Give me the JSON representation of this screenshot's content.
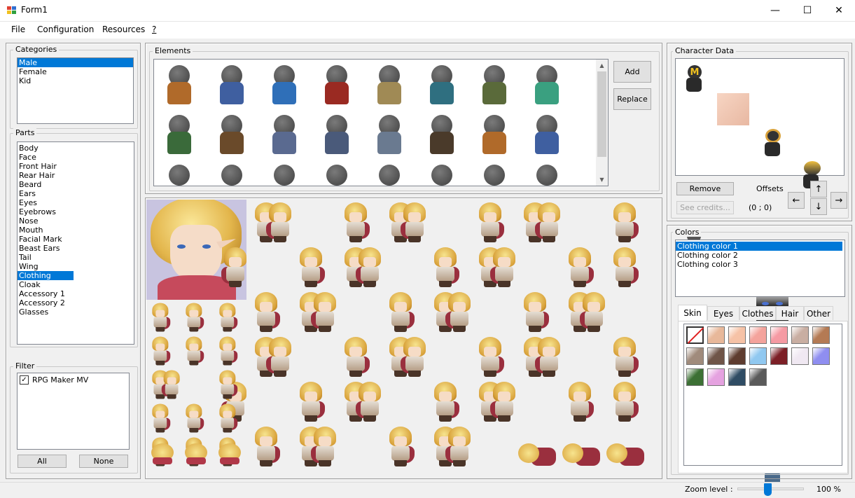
{
  "window": {
    "title": "Form1",
    "minimize_glyph": "—",
    "maximize_glyph": "☐",
    "close_glyph": "✕"
  },
  "menu": {
    "file": "File",
    "configuration": "Configuration",
    "resources": "Resources",
    "help": "?"
  },
  "categories": {
    "legend": "Categories",
    "items": [
      "Male",
      "Female",
      "Kid"
    ],
    "selected": "Male"
  },
  "parts": {
    "legend": "Parts",
    "items": [
      "Body",
      "Face",
      "Front Hair",
      "Rear Hair",
      "Beard",
      "Ears",
      "Eyes",
      "Eyebrows",
      "Nose",
      "Mouth",
      "Facial Mark",
      "Beast Ears",
      "Tail",
      "Wing",
      "Clothing",
      "Cloak",
      "Accessory 1",
      "Accessory 2",
      "Glasses"
    ],
    "selected": "Clothing"
  },
  "filter": {
    "legend": "Filter",
    "items": [
      {
        "label": "RPG Maker MV",
        "checked": true
      }
    ],
    "all_label": "All",
    "none_label": "None"
  },
  "elements": {
    "legend": "Elements",
    "add_label": "Add",
    "replace_label": "Replace",
    "scroll_up": "▲",
    "scroll_down": "▼",
    "variants": [
      "#b06a2a",
      "#3f5fa0",
      "#2f6fb8",
      "#9a2a22",
      "#a08a55",
      "#2f6f80",
      "#5a6a3a",
      "#3aa080",
      "#3a6a3a",
      "#6a4a2a",
      "#5a6a90",
      "#4a5a7a",
      "#6a7a90",
      "#4a3a2a"
    ]
  },
  "character_data": {
    "legend": "Character Data",
    "remove_label": "Remove",
    "see_credits_label": "See credits...",
    "offsets_label": "Offsets",
    "offsets_value": "(0 ; 0)",
    "arrow_up": "↑",
    "arrow_down": "↓",
    "arrow_left": "←",
    "arrow_right": "→",
    "emblem_letter": "M"
  },
  "colors": {
    "legend": "Colors",
    "items": [
      "Clothing color 1",
      "Clothing color 2",
      "Clothing color 3"
    ],
    "selected": "Clothing color 1",
    "tabs": [
      "Skin",
      "Eyes",
      "Clothes",
      "Hair",
      "Other"
    ],
    "active_tab": "Skin",
    "swatches": [
      "none",
      "#e8b89a",
      "#f6c2a6",
      "#f4a39c",
      "#f59aa3",
      "#c9aea2",
      "#b47a54",
      "#a08b7c",
      "#6f5548",
      "#5e3c2f",
      "#90c8f0",
      "#7c1f26",
      "#f0e8f2",
      "#8f8ef0",
      "#3c7034",
      "#e5a2e0",
      "#2f4c64",
      "#5a5a5a"
    ]
  },
  "status": {
    "zoom_label": "Zoom level :",
    "zoom_value": "100 %",
    "zoom_fraction": 0.4
  }
}
